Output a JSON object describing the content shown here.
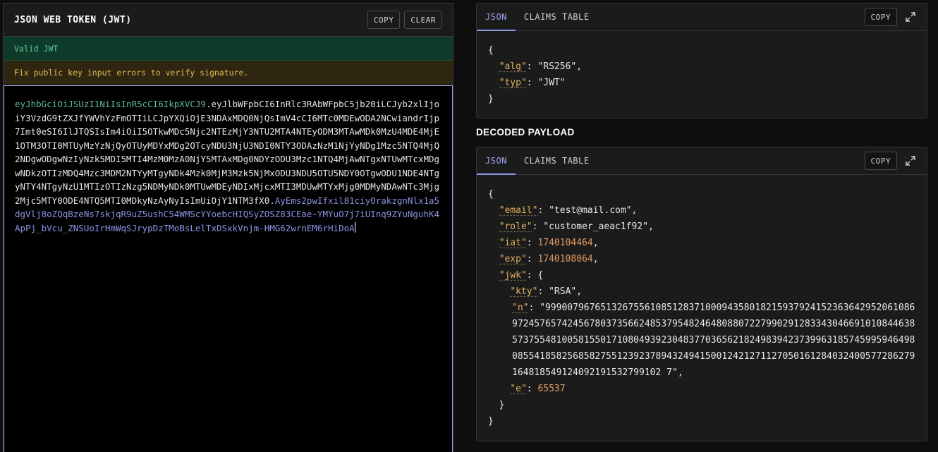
{
  "left": {
    "title": "JSON WEB TOKEN (JWT)",
    "copy_label": "COPY",
    "clear_label": "CLEAR",
    "status_valid": "Valid JWT",
    "status_warning": "Fix public key input errors to verify signature.",
    "token_header": "eyJhbGciOiJSUzI1NiIsInR5cCI6IkpXVCJ9",
    "token_payload": "eyJlbWFpbCI6InRlc3RAbWFpbC5jb20iLCJyb2xlIjoiY3VzdG9tZXJfYWVhYzFmOTIiLCJpYXQiOjE3NDAxMDQ0NjQsImV4cCI6MTc0MDEwODA2NCwiandrIjp7Imt0eSI6IlJTQSIsIm4iOiI5OTkwMDc5Njc2NTEzMjY3NTU2MTA4NTEyODM3MTAwMDk0MzU4MDE4MjE1OTM3OTI0MTUyMzYzNjQyOTUyMDYxMDg2OTcyNDU3NjU3NDI0NTY3ODAzNzM1NjYyNDg1Mzc5NTQ4MjQ2NDgwODgwNzIyNzk5MDI5MTI4MzM0MzA0NjY5MTAxMDg0NDYzODU3Mzc1NTQ4MjAwNTgxNTUwMTcxMDgwNDkzOTIzMDQ4Mzc3MDM2NTYyMTgyNDk4Mzk0MjM3Mzk5NjMxODU3NDU5OTU5NDY0OTgwODU1NDE4NTgyNTY4NTgyNzU1MTIzOTIzNzg5NDMyNDk0MTUwMDEyNDIxMjcxMTI3MDUwMTYxMjg0MDMyNDAwNTc3Mjg2Mjc5MTY0ODE4NTQ5MTI0MDkyNzAyNyIsImUiOjY1NTM3fX0",
    "token_signature": "AyEms2pwIfxil81ciyOrakzgnNlx1a5dgVlj8oZQqBzeNs7skjqR9uZ5ushC54WMScYYoebcHIQSyZOSZ83CEae-YMYuO7j7iUInq9ZYuNguhK4ApPj_bVcu_ZNSUoIrHmWqSJrypDzTMoBsLelTxDSxkVnjm-HMG62wrnEM6rHiDoA"
  },
  "header_card": {
    "tab_json": "JSON",
    "tab_claims": "CLAIMS TABLE",
    "copy_label": "COPY",
    "alg_key": "\"alg\"",
    "alg_value": "\"RS256\"",
    "typ_key": "\"typ\"",
    "typ_value": "\"JWT\""
  },
  "payload_section_title": "DECODED PAYLOAD",
  "payload_card": {
    "tab_json": "JSON",
    "tab_claims": "CLAIMS TABLE",
    "copy_label": "COPY",
    "email_key": "\"email\"",
    "email_value": "\"test@mail.com\"",
    "role_key": "\"role\"",
    "role_value": "\"customer_aeac1f92\"",
    "iat_key": "\"iat\"",
    "iat_value": "1740104464",
    "exp_key": "\"exp\"",
    "exp_value": "1740108064",
    "jwk_key": "\"jwk\"",
    "kty_key": "\"kty\"",
    "kty_value": "\"RSA\"",
    "n_key": "\"n\"",
    "n_value": "\"9990079676513267556108512837100094358018215937924152363642952061086972457657424567803735662485379548246480880722799029128334304669101084463857375548100581550171080493923048377036562182498394237399631857459959464980855418582568582755123923789432494150012421271127050161284032400577286279164818549124092191532799102 7\"",
    "e_key": "\"e\"",
    "e_value": "65537"
  },
  "colors": {
    "accent": "#8d96e0",
    "valid": "#63c79c",
    "warning": "#e3bc52",
    "key": "#e3b05f",
    "number": "#e29a62"
  },
  "icons": [
    "expand-icon"
  ]
}
